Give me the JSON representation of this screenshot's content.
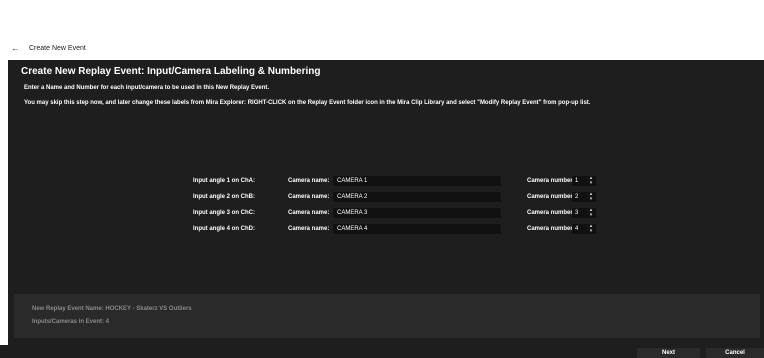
{
  "window": {
    "title": "Create New Event"
  },
  "heading": "Create New Replay Event: Input/Camera Labeling & Numbering",
  "instructions": [
    "Enter a Name and Number for each input/camera to be used in this New Replay Event.",
    "You may skip this step now, and later change these labels from Mira Explorer: RIGHT-CLICK on the Replay Event folder icon in the Mira Clip Library and select \"Modify Replay Event\" from pop-up list."
  ],
  "labels": {
    "camera_name": "Camera name:",
    "camera_number": "Camera number:"
  },
  "inputs": [
    {
      "angle_label": "Input angle 1 on ChA:",
      "camera_name": "CAMERA 1",
      "camera_number": "1"
    },
    {
      "angle_label": "Input angle 2 on ChB:",
      "camera_name": "CAMERA 2",
      "camera_number": "2"
    },
    {
      "angle_label": "Input angle 3 on ChC:",
      "camera_name": "CAMERA 3",
      "camera_number": "3"
    },
    {
      "angle_label": "Input angle 4 on ChD:",
      "camera_name": "CAMERA 4",
      "camera_number": "4"
    }
  ],
  "summary": {
    "event_name": "New Replay Event Name: HOCKEY - Skaterz VS Outliers",
    "inputs_count": "Inputs/Cameras in Event: 4"
  },
  "buttons": {
    "next": "Next",
    "cancel": "Cancel"
  },
  "icons": {
    "back": "back-arrow-icon",
    "spinner": "spinner-updown-icon"
  },
  "colors": {
    "background": "#1e1e1e",
    "field": "#111111",
    "summary": "#2a2a2a"
  }
}
